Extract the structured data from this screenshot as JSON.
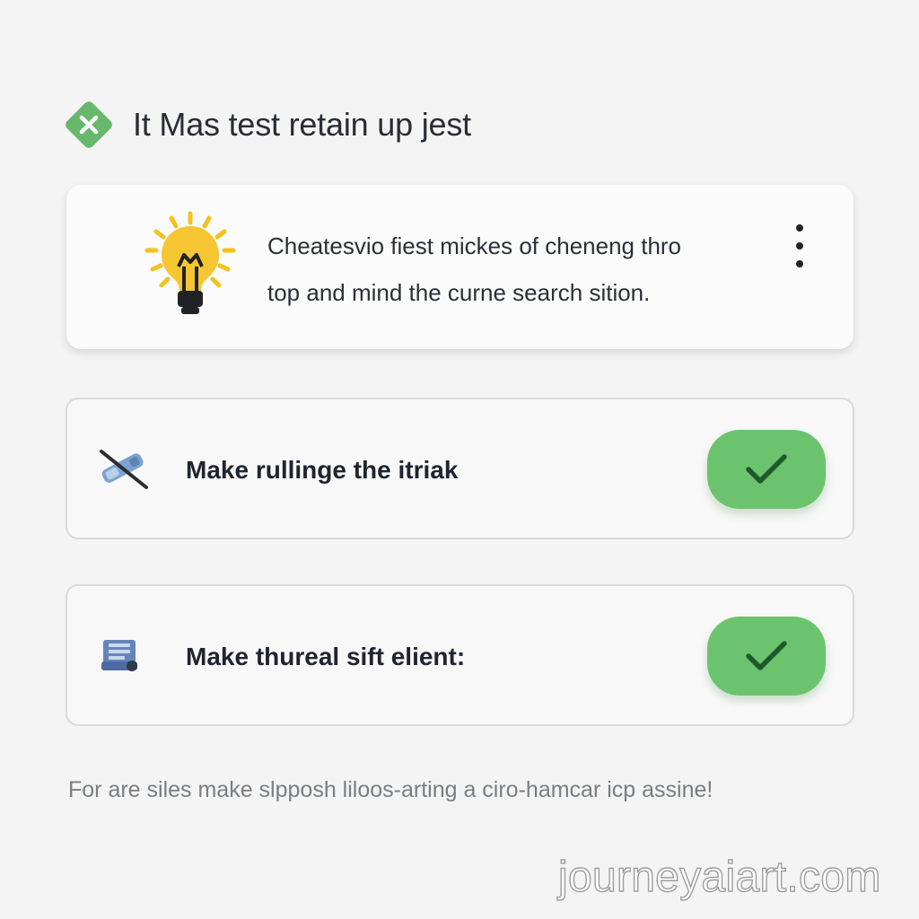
{
  "header": {
    "title": "It Mas test retain up jest",
    "icon_name": "x-diamond-icon",
    "accent_color": "#67b86a"
  },
  "tip_card": {
    "text_line_1": "Cheatesvio fiest mickes of cheneng thro",
    "text_line_2": "top and mind the curne search sition.",
    "icon_name": "lightbulb-icon",
    "menu_icon_name": "vertical-ellipsis-icon"
  },
  "tasks": [
    {
      "label": "Make rullinge the itriak",
      "icon_name": "crossed-pen-icon",
      "check_icon_name": "check-icon",
      "check_color": "#6cc36e"
    },
    {
      "label": "Make thureal sift elient:",
      "icon_name": "document-list-icon",
      "check_icon_name": "check-icon",
      "check_color": "#6cc36e"
    }
  ],
  "footer": {
    "note": "For are siles make slpposh liloos-arting a ciro-hamcar icp assine!"
  },
  "watermark": {
    "text": "journeyaiart.com"
  }
}
